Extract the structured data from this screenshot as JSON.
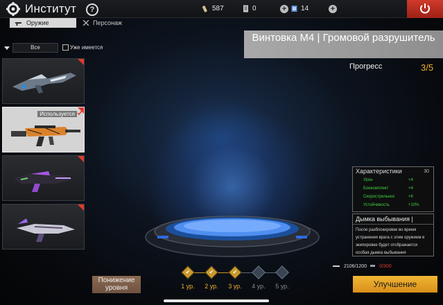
{
  "header": {
    "title": "Институт",
    "help": "?",
    "resources": [
      {
        "icon": "part-icon",
        "value": "587"
      },
      {
        "icon": "card-icon",
        "value": "0"
      },
      {
        "icon": "crate-icon",
        "value": "14"
      }
    ]
  },
  "tabs": [
    {
      "label": "Оружие",
      "icon": "rifle-icon",
      "active": true
    },
    {
      "label": "Персонаж",
      "icon": "character-icon",
      "active": false
    }
  ],
  "filter": {
    "selected": "Все",
    "owned_label": "Уже имеется"
  },
  "weapon_list": [
    {
      "name": "weapon-shark-skin",
      "selected": false,
      "used_label": ""
    },
    {
      "name": "weapon-m4-thunder",
      "selected": true,
      "used_label": "Используется"
    },
    {
      "name": "weapon-purple-smg",
      "selected": false,
      "used_label": ""
    },
    {
      "name": "weapon-violet-crystal",
      "selected": false,
      "used_label": ""
    }
  ],
  "weapon": {
    "title": "Винтовка M4 | Громовой разрушитель",
    "progress_label": "Прогресс",
    "progress_value": "3/5"
  },
  "stats": {
    "title": "Характеристики",
    "count": "30",
    "rows": [
      {
        "label": "Урон",
        "value": "+4"
      },
      {
        "label": "Боекомплект",
        "value": "+4"
      },
      {
        "label": "Скорострельнос",
        "value": "+6"
      },
      {
        "label": "Устойчивость",
        "value": "+10%"
      }
    ]
  },
  "ability": {
    "title": "Дымка выбывания |",
    "text": "После разблокировки во время устранения врага с этим оружием в экипировке будет отображается особая дымка выбывания"
  },
  "bottom": {
    "downgrade_label": "Понижение уровня",
    "levels": [
      {
        "label": "1 ур.",
        "done": true
      },
      {
        "label": "2 ур.",
        "done": true
      },
      {
        "label": "3 ур.",
        "done": true
      },
      {
        "label": "4 ур.",
        "done": false
      },
      {
        "label": "5 ур.",
        "done": false
      }
    ],
    "parts_have": "2106/1200",
    "parts_need": "0/300",
    "upgrade_label": "Улучшение"
  },
  "colors": {
    "accent": "#f0b030",
    "danger": "#e03a2e",
    "stat_green": "#3fd33f"
  }
}
